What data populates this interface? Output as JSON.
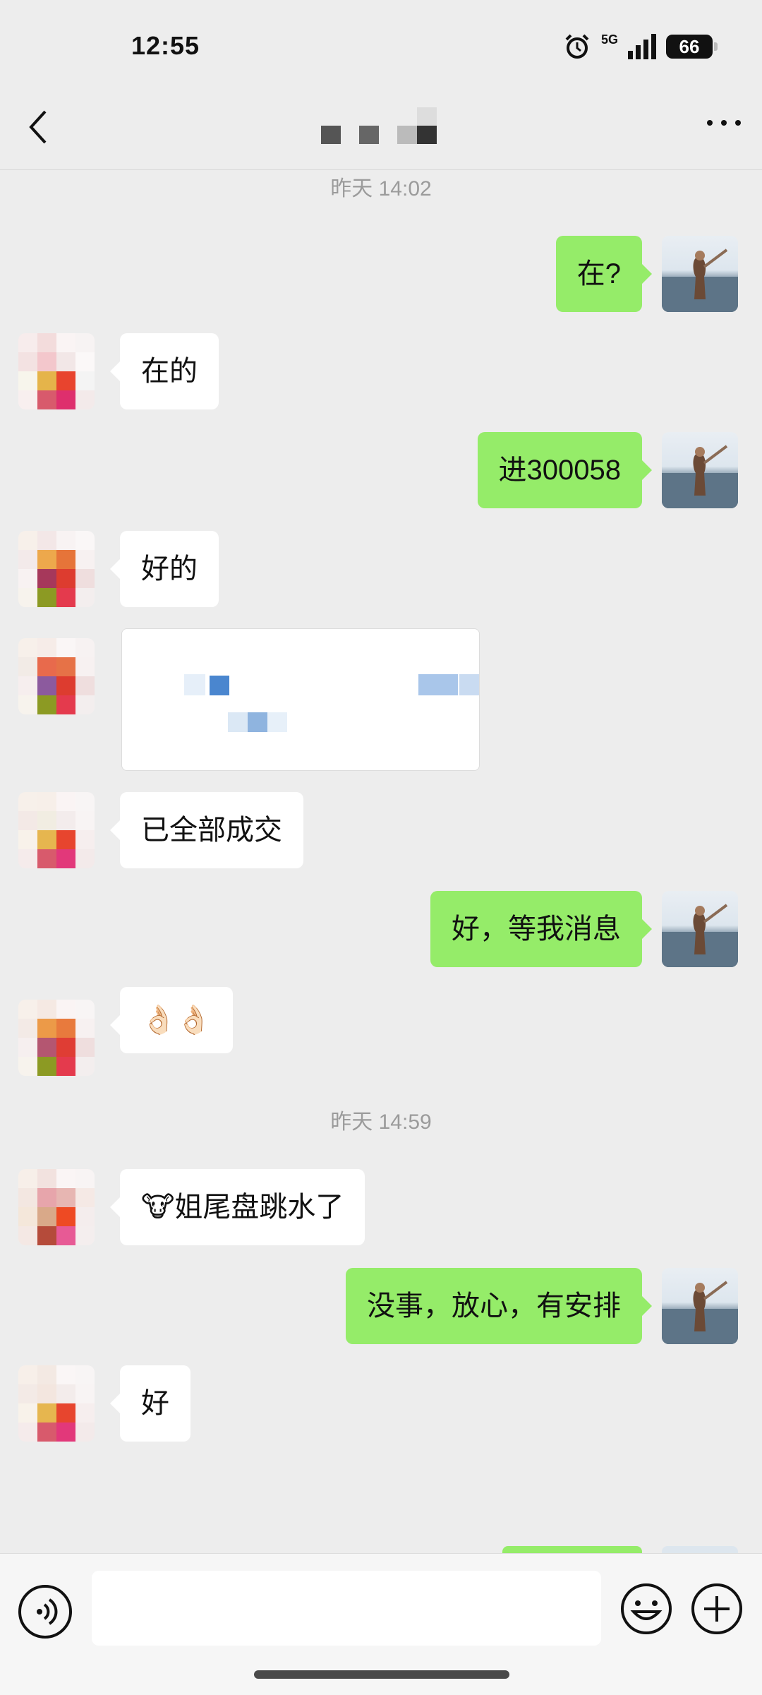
{
  "status_bar": {
    "time": "12:55",
    "network": "5G",
    "battery": "66"
  },
  "header": {
    "contact_name": "■ ■ ▪■",
    "back_icon": "chevron-left-icon",
    "more_icon": "more-dots-icon"
  },
  "messages": {
    "timestamp1": "昨天 14:02",
    "m1": "在?",
    "m2": "在的",
    "m3": "进300058",
    "m4": "好的",
    "m6": "已全部成交",
    "m7": "好，等我消息",
    "m8": "👌🏻👌🏻",
    "timestamp2": "昨天 14:59",
    "m9": "🐮姐尾盘跳水了",
    "m10": "没事，放心，有安排",
    "m11": "好"
  },
  "input_bar": {
    "placeholder": "",
    "voice_icon": "voice-icon",
    "emoji_icon": "emoji-icon",
    "add_icon": "plus-circle-icon"
  },
  "colors": {
    "outgoing_bubble": "#95ec69",
    "incoming_bubble": "#ffffff",
    "background": "#ededed"
  }
}
